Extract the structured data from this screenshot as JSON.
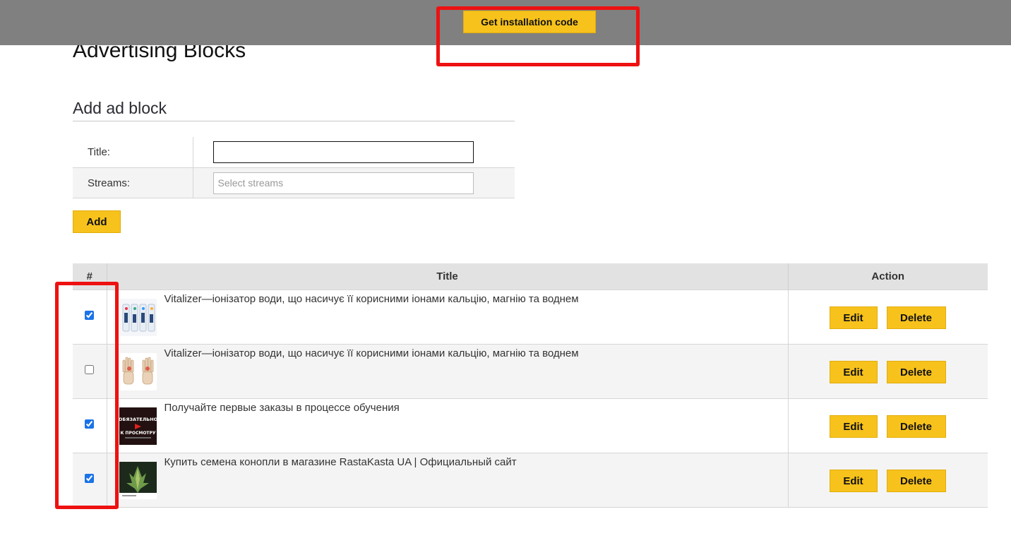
{
  "topbar": {
    "install_button": "Get installation code"
  },
  "page": {
    "title": "Advertising Blocks"
  },
  "form": {
    "section_title": "Add ad block",
    "title_label": "Title:",
    "title_value": "",
    "streams_label": "Streams:",
    "streams_placeholder": "Select streams",
    "add_button": "Add"
  },
  "table": {
    "headers": {
      "num": "#",
      "title": "Title",
      "action": "Action"
    },
    "edit_label": "Edit",
    "delete_label": "Delete",
    "rows": [
      {
        "checked": true,
        "title": "Vitalizer—іонізатор води, що насичує її корисними іонами кальцію, магнію та воднем",
        "thumb": "water-ionizer-product-thumbnail"
      },
      {
        "checked": false,
        "title": "Vitalizer—іонізатор води, що насичує її корисними іонами кальцію, магнію та воднем",
        "thumb": "hands-xray-thumbnail"
      },
      {
        "checked": true,
        "title": "Получайте первые заказы в процессе обучения",
        "thumb": "video-promo-thumbnail",
        "thumb_text": [
          "ОБЯЗАТЕЛЬНО",
          "К ПРОСМОТРУ"
        ]
      },
      {
        "checked": true,
        "title": "Купить семена конопли в магазине RastaKasta UA | Официальный сайт",
        "thumb": "cannabis-plant-thumbnail"
      }
    ]
  },
  "colors": {
    "accent": "#f7c21c",
    "highlight": "#ee1111",
    "topbar": "#808080"
  }
}
